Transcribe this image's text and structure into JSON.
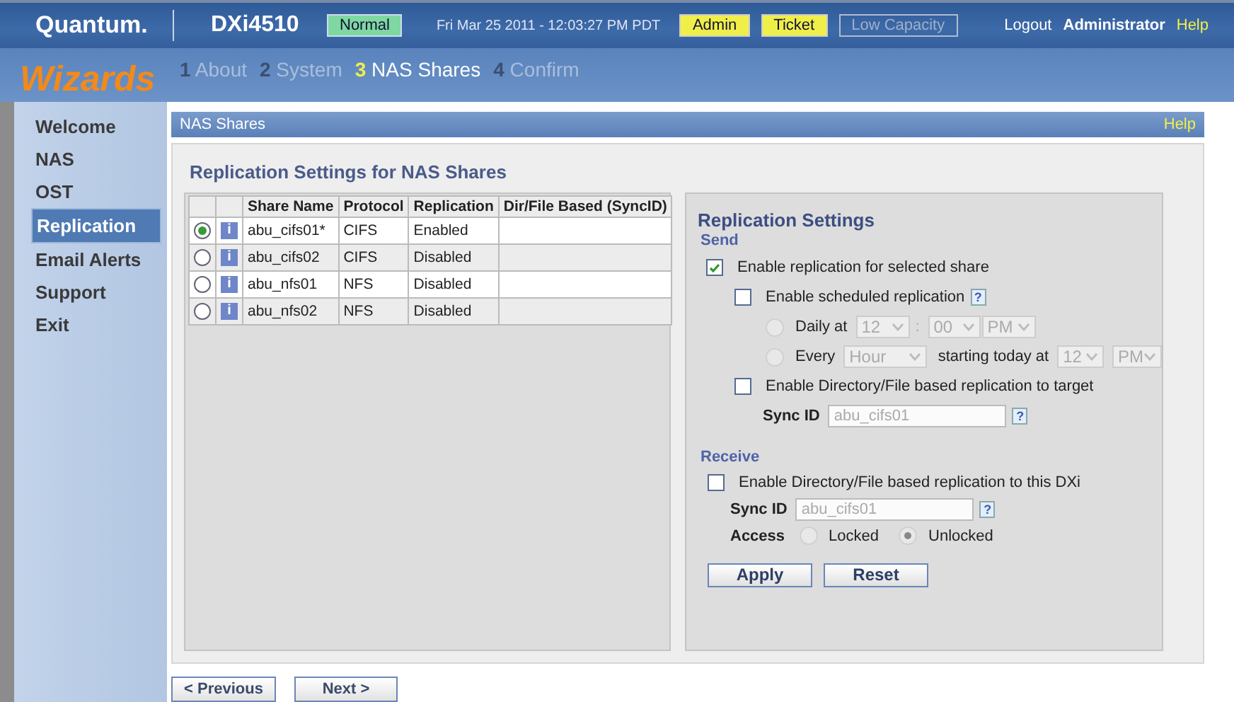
{
  "header": {
    "logo": "Quantum.",
    "model": "DXi4510",
    "status": "Normal",
    "datetime": "Fri Mar 25 2011 - 12:03:27 PM PDT",
    "badges": [
      {
        "label": "Admin",
        "active": true
      },
      {
        "label": "Ticket",
        "active": true
      },
      {
        "label": "Low Capacity",
        "active": false
      }
    ],
    "logout": "Logout",
    "user": "Administrator",
    "help": "Help"
  },
  "wizard": {
    "title": "Wizards",
    "steps": [
      {
        "number": "1",
        "label": "About",
        "selected": false
      },
      {
        "number": "2",
        "label": "System",
        "selected": false
      },
      {
        "number": "3",
        "label": "NAS Shares",
        "selected": true
      },
      {
        "number": "4",
        "label": "Confirm",
        "selected": false
      }
    ]
  },
  "sidebar": {
    "items": [
      {
        "label": "Welcome",
        "selected": false
      },
      {
        "label": "NAS",
        "selected": false
      },
      {
        "label": "OST",
        "selected": false
      },
      {
        "label": "Replication",
        "selected": true
      },
      {
        "label": "Email Alerts",
        "selected": false
      },
      {
        "label": "Support",
        "selected": false
      },
      {
        "label": "Exit",
        "selected": false
      }
    ]
  },
  "panel": {
    "title": "NAS Shares",
    "help": "Help",
    "heading": "Replication Settings for NAS Shares",
    "table": {
      "columns": [
        "Share Name",
        "Protocol",
        "Replication",
        "Dir/File Based (SyncID)"
      ],
      "rows": [
        {
          "selected": true,
          "info": "i",
          "share_name": "abu_cifs01*",
          "protocol": "CIFS",
          "replication": "Enabled"
        },
        {
          "selected": false,
          "info": "i",
          "share_name": "abu_cifs02",
          "protocol": "CIFS",
          "replication": "Disabled"
        },
        {
          "selected": false,
          "info": "i",
          "share_name": "abu_nfs01",
          "protocol": "NFS",
          "replication": "Disabled"
        },
        {
          "selected": false,
          "info": "i",
          "share_name": "abu_nfs02",
          "protocol": "NFS",
          "replication": "Disabled"
        }
      ]
    },
    "settings": {
      "title": "Replication Settings",
      "send": {
        "label": "Send",
        "enable_replication": {
          "label": "Enable replication for selected share",
          "checked": true
        },
        "scheduled": {
          "label": "Enable scheduled replication",
          "checked": false,
          "help": "?"
        },
        "daily": {
          "label": "Daily at",
          "selected": false,
          "disabled": true,
          "hour": "12",
          "separator": ":",
          "minute": "00",
          "ampm": "PM"
        },
        "every": {
          "label": "Every",
          "selected": false,
          "disabled": true,
          "unit": "Hour",
          "starting": "starting today at",
          "hour": "12",
          "ampm": "PM"
        },
        "dir_target": {
          "label": "Enable Directory/File based replication to target",
          "checked": false
        },
        "sync_id": {
          "label": "Sync ID",
          "value": "abu_cifs01",
          "disabled": true,
          "help": "?"
        }
      },
      "receive": {
        "label": "Receive",
        "enable": {
          "label": "Enable Directory/File based replication to this DXi",
          "checked": false
        },
        "sync_id": {
          "label": "Sync ID",
          "value": "abu_cifs01",
          "disabled": true,
          "help": "?"
        },
        "access": {
          "label": "Access",
          "options": [
            {
              "label": "Locked",
              "selected": false,
              "disabled": true
            },
            {
              "label": "Unlocked",
              "selected": true,
              "disabled": true
            }
          ]
        }
      },
      "buttons": [
        "Apply",
        "Reset"
      ]
    }
  },
  "navigation": [
    "< Previous",
    "Next >"
  ]
}
